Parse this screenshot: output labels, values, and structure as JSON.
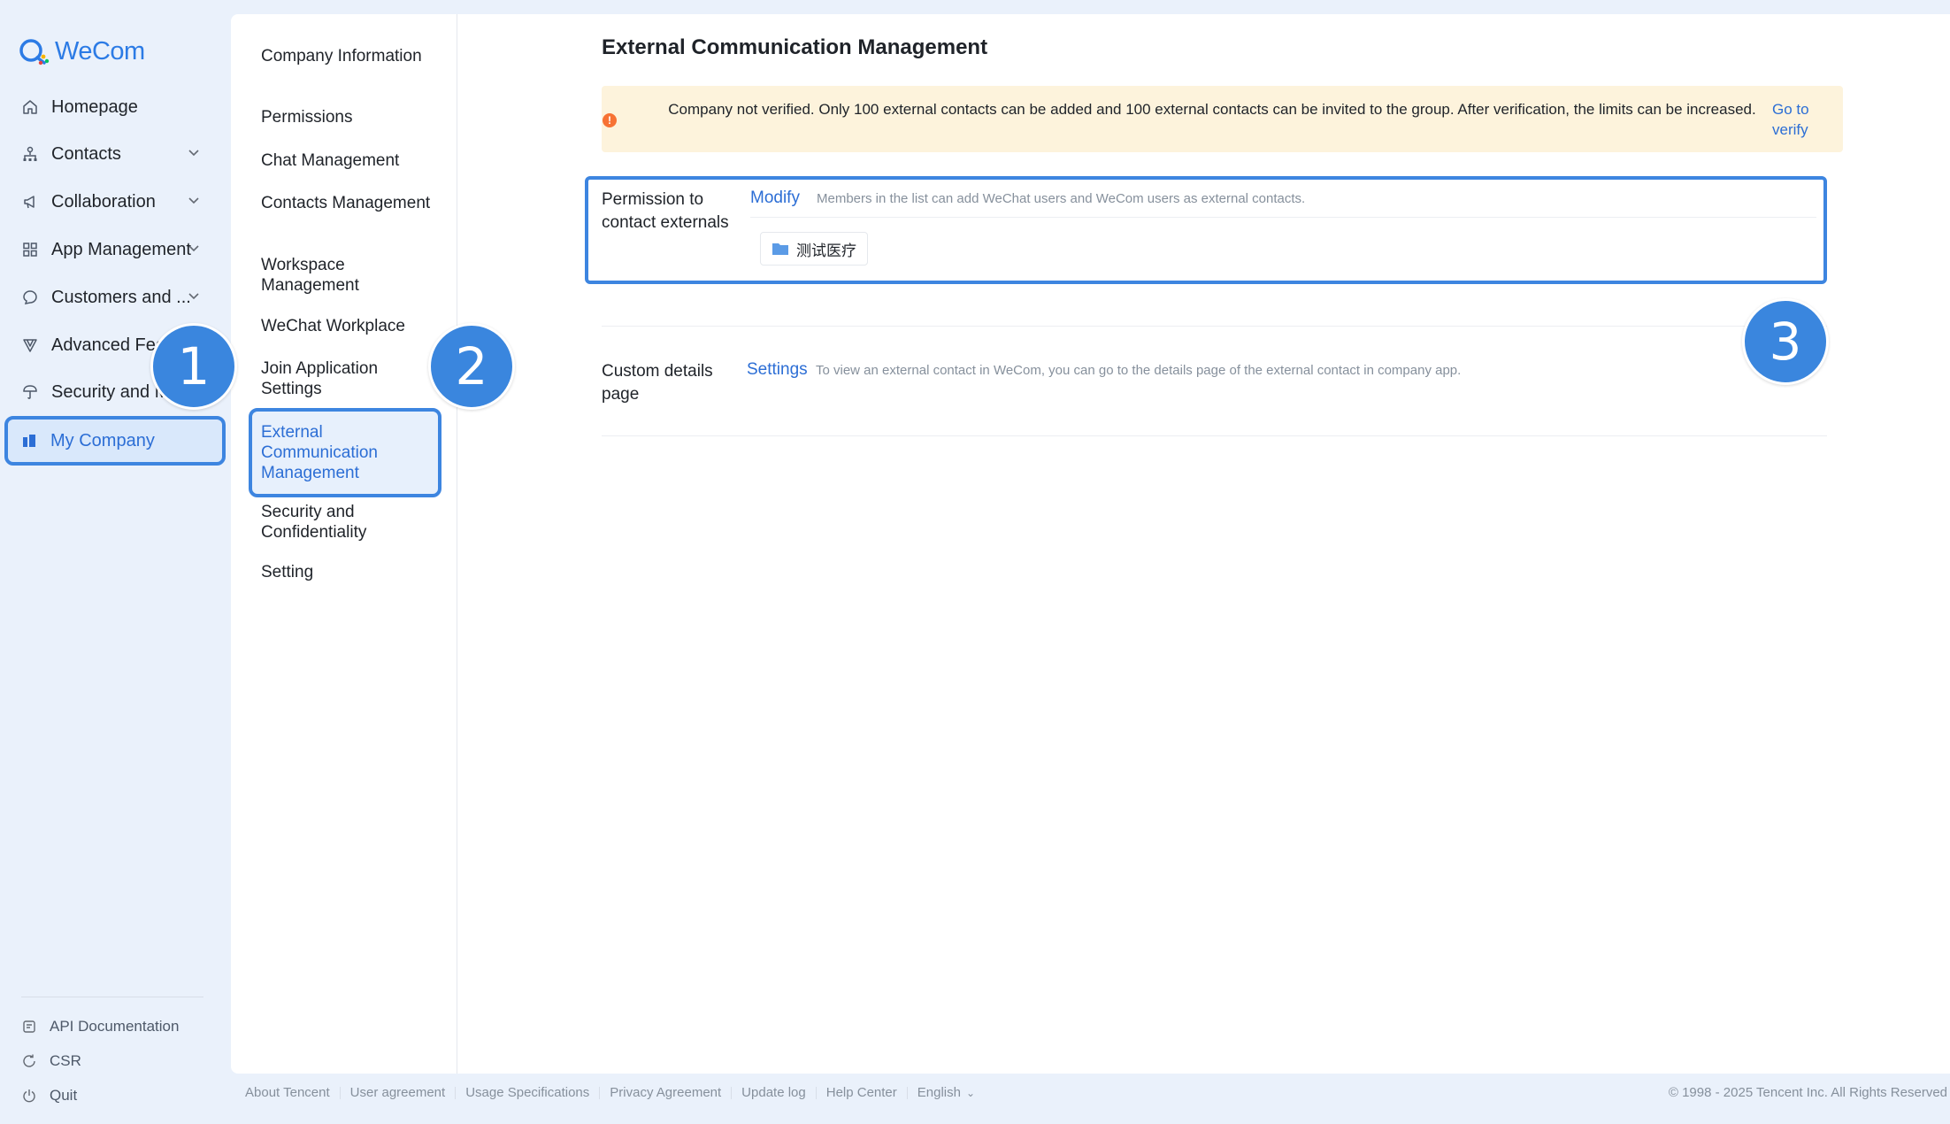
{
  "app": {
    "name": "WeCom"
  },
  "sidebar": {
    "items": [
      {
        "label": "Homepage",
        "icon": "home-icon"
      },
      {
        "label": "Contacts",
        "icon": "org-icon",
        "expandable": true
      },
      {
        "label": "Collaboration",
        "icon": "megaphone-icon",
        "expandable": true
      },
      {
        "label": "App Management",
        "icon": "grid-icon",
        "expandable": true
      },
      {
        "label": "Customers and ...",
        "icon": "chat-bubble-icon",
        "expandable": true
      },
      {
        "label": "Advanced Feat",
        "icon": "v-icon"
      },
      {
        "label": "Security and Ma",
        "icon": "shield-icon"
      },
      {
        "label": "My Company",
        "icon": "building-icon",
        "active": true
      }
    ],
    "bottom": [
      {
        "label": "API Documentation",
        "icon": "document-icon"
      },
      {
        "label": "CSR",
        "icon": "refresh-icon"
      },
      {
        "label": "Quit",
        "icon": "power-icon"
      }
    ]
  },
  "subnav": {
    "items": [
      {
        "label": "Company Information"
      },
      {
        "label": "Permissions"
      },
      {
        "label": "Chat Management"
      },
      {
        "label": "Contacts Management"
      },
      {
        "label": "Workspace Management"
      },
      {
        "label": "WeChat Workplace"
      },
      {
        "label": "Join Application Settings"
      },
      {
        "label": "External Communication Management",
        "active": true
      },
      {
        "label": "Security and Confidentiality"
      },
      {
        "label": "Setting"
      }
    ]
  },
  "main": {
    "title": "External Communication Management",
    "alert": {
      "message": "Company not verified. Only 100 external contacts can be added and 100 external contacts can be invited to the group. After verification, the limits can be increased.",
      "link": "Go to verify"
    },
    "permission": {
      "label": "Permission to contact externals",
      "action": "Modify",
      "description": "Members in the list can add WeChat users and WeCom users as external contacts.",
      "tags": [
        "测试医疗"
      ]
    },
    "details": {
      "label": "Custom details page",
      "action": "Settings",
      "description": "To view an external contact in WeCom, you can go to the details page of the external contact in company app."
    }
  },
  "footer": {
    "links": [
      "About Tencent",
      "User agreement",
      "Usage Specifications",
      "Privacy Agreement",
      "Update log",
      "Help Center",
      "English"
    ],
    "copyright": "© 1998 - 2025 Tencent Inc. All Rights Reserved"
  },
  "badges": [
    "1",
    "2",
    "3"
  ],
  "colors": {
    "accent": "#2c6ed5",
    "highlight": "#3d85e0",
    "badge": "#3a86de",
    "alert_bg": "#fdf3dc",
    "warn": "#f77234"
  }
}
